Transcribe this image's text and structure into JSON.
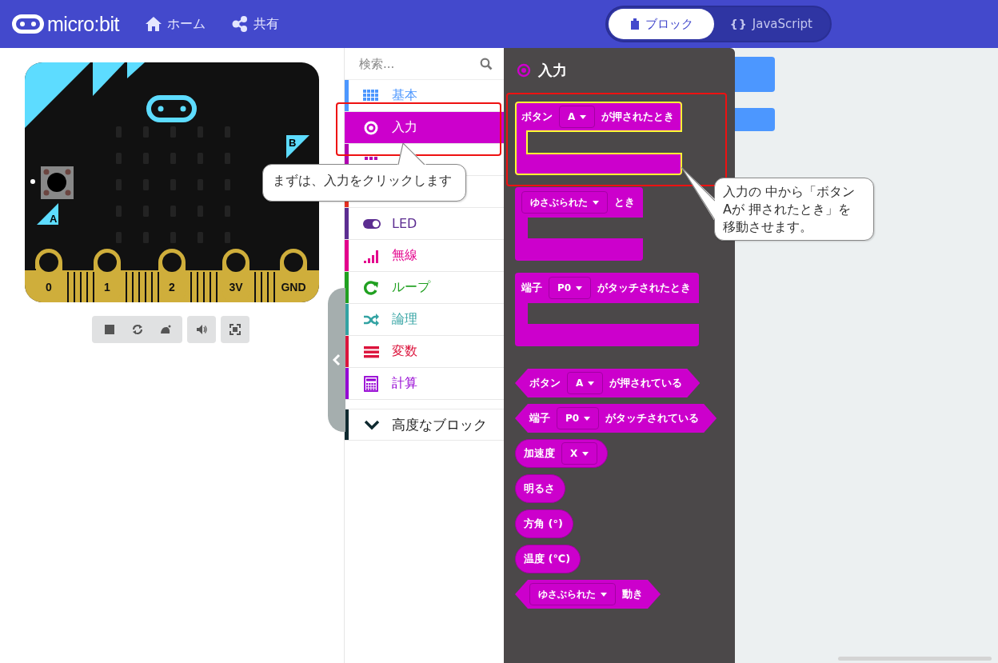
{
  "header": {
    "logo": "micro:bit",
    "nav": [
      {
        "label": "ホーム"
      },
      {
        "label": "共有"
      }
    ],
    "editor_toggle": [
      {
        "label": "ブロック",
        "selected": true
      },
      {
        "label": "JavaScript",
        "symbol": "{}",
        "selected": false
      }
    ]
  },
  "simulator": {
    "pins": [
      "0",
      "1",
      "2",
      "3V",
      "GND"
    ],
    "buttons": [
      "A",
      "B"
    ]
  },
  "toolbox": {
    "search": {
      "placeholder": "検索..."
    },
    "categories": [
      {
        "label": "基本",
        "color": "#4c97ff",
        "selected": false
      },
      {
        "label": "入力",
        "color": "#cc00cc",
        "selected": true
      },
      {
        "color": "#b000b0",
        "selected": false
      },
      {
        "color": "#e63022",
        "selected": false
      },
      {
        "label": "LED",
        "color": "#5c2d91",
        "selected": false
      },
      {
        "label": "無線",
        "color": "#e3008c",
        "selected": false
      },
      {
        "label": "ループ",
        "color": "#20a020",
        "selected": false
      },
      {
        "label": "論理",
        "color": "#33a3a3",
        "selected": false
      },
      {
        "label": "変数",
        "color": "#dc143c",
        "selected": false
      },
      {
        "label": "計算",
        "color": "#9400d3",
        "selected": false
      }
    ],
    "advanced": {
      "label": "高度なブロック",
      "color": "#0f2a30",
      "expanded": false
    }
  },
  "flyout": {
    "title": "入力",
    "blocks": [
      {
        "kind": "hat",
        "selected": true,
        "parts": [
          {
            "text": "ボタン"
          },
          {
            "dropdown": "A"
          },
          {
            "text": "が押されたとき"
          }
        ]
      },
      {
        "kind": "hat",
        "selected": false,
        "parts": [
          {
            "dropdown": "ゆさぶられた"
          },
          {
            "text": "とき"
          }
        ]
      },
      {
        "kind": "hat",
        "selected": false,
        "parts": [
          {
            "text": "端子"
          },
          {
            "dropdown": "P0"
          },
          {
            "text": "がタッチされたとき"
          }
        ]
      },
      {
        "kind": "boolean",
        "selected": false,
        "parts": [
          {
            "text": "ボタン"
          },
          {
            "dropdown": "A"
          },
          {
            "text": "が押されている"
          }
        ]
      },
      {
        "kind": "boolean",
        "selected": false,
        "parts": [
          {
            "text": "端子"
          },
          {
            "dropdown": "P0"
          },
          {
            "text": "がタッチされている"
          }
        ]
      },
      {
        "kind": "reporter",
        "selected": false,
        "parts": [
          {
            "text": "加速度"
          },
          {
            "dropdown": "X"
          }
        ]
      },
      {
        "kind": "reporter",
        "selected": false,
        "parts": [
          {
            "text": "明るさ"
          }
        ]
      },
      {
        "kind": "reporter",
        "selected": false,
        "parts": [
          {
            "text": "方角 (°)"
          }
        ]
      },
      {
        "kind": "reporter",
        "selected": false,
        "parts": [
          {
            "text": "温度 (℃)"
          }
        ]
      },
      {
        "kind": "boolean",
        "selected": false,
        "parts": [
          {
            "dropdown": "ゆさぶられた"
          },
          {
            "text": "動き"
          }
        ]
      }
    ]
  },
  "callouts": [
    {
      "text": "まずは、入力をクリックします"
    },
    {
      "text": "入力の 中から「ボタンAが 押されたとき」を移動させます。"
    }
  ]
}
